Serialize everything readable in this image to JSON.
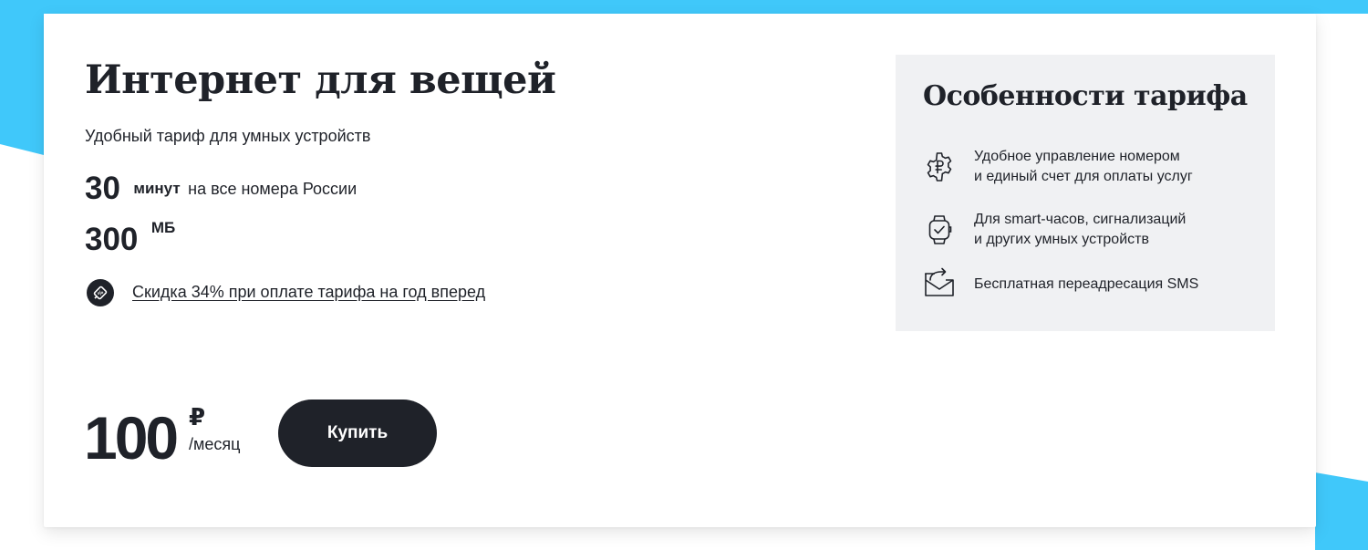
{
  "colors": {
    "background_accent": "#40c8fa",
    "text_dark": "#1f2229",
    "button_bg": "#1f2229",
    "button_text": "#ffffff",
    "features_bg": "#f0f1f3"
  },
  "tariff": {
    "title": "Интернет для вещей",
    "subtitle": "Удобный тариф для умных устройств",
    "minutes": {
      "value": "30",
      "unit": "минут",
      "desc": "на все номера России"
    },
    "data": {
      "value": "300",
      "unit": "МБ"
    },
    "discount": {
      "icon": "discount-tag-icon",
      "label": "Скидка 34% при оплате тарифа на год вперед"
    },
    "price": {
      "amount": "100",
      "currency": "₽",
      "period": "/месяц"
    },
    "buy_label": "Купить"
  },
  "features": {
    "title": "Особенности тарифа",
    "items": [
      {
        "icon": "ruble-gear-icon",
        "line1": "Удобное управление номером",
        "line2": "и единый счет для оплаты услуг"
      },
      {
        "icon": "smartwatch-icon",
        "line1": "Для smart-часов, сигнализаций",
        "line2": "и других умных устройств"
      },
      {
        "icon": "sms-forward-icon",
        "line1": "Бесплатная переадресация SMS",
        "line2": ""
      }
    ]
  }
}
